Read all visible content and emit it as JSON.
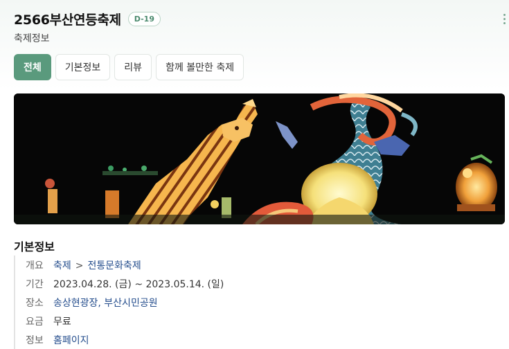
{
  "header": {
    "title": "2566부산연등축제",
    "dday": "D-19",
    "subtitle": "축제정보"
  },
  "tabs": [
    {
      "label": "전체",
      "active": true
    },
    {
      "label": "기본정보",
      "active": false
    },
    {
      "label": "리뷰",
      "active": false
    },
    {
      "label": "함께 볼만한 축제",
      "active": false
    }
  ],
  "section": {
    "title": "기본정보",
    "overview_label": "개요",
    "overview_category": "축제",
    "overview_separator": ">",
    "overview_subcategory": "전통문화축제",
    "period_label": "기간",
    "period_value": "2023.04.28. (금) ~ 2023.05.14. (일)",
    "place_label": "장소",
    "place_value": "송상현광장, 부산시민공원",
    "fee_label": "요금",
    "fee_value": "무료",
    "info_label": "정보",
    "info_value": "홈페이지"
  },
  "colors": {
    "accent": "#5a9a7d",
    "link": "#234c8c"
  },
  "icons": {
    "more": "kebab-menu-icon"
  }
}
